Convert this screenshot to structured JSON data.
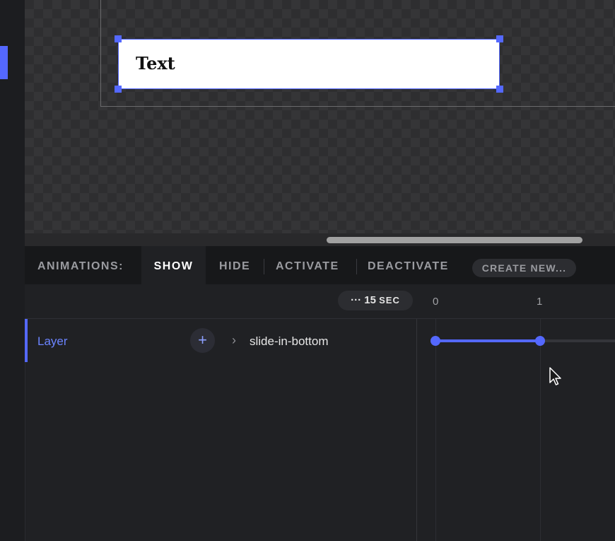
{
  "canvas": {
    "text_layer": {
      "content": "Text"
    }
  },
  "animations": {
    "label": "ANIMATIONS:",
    "tabs": [
      "SHOW",
      "HIDE",
      "ACTIVATE",
      "DEACTIVATE"
    ],
    "active_tab": "SHOW",
    "create_new": "CREATE NEW..."
  },
  "timeline": {
    "duration_dots": "···",
    "duration_value": "15",
    "duration_unit": "SEC",
    "ticks": [
      "0",
      "1"
    ]
  },
  "layer": {
    "name": "Layer",
    "add_symbol": "+",
    "expand_symbol": "›",
    "animation_name": "slide-in-bottom"
  },
  "colors": {
    "accent": "#5468ff",
    "bg": "#202124",
    "tabs_bg": "#17181a"
  },
  "icons": {
    "add": "plus-icon",
    "expand": "chevron-right-icon",
    "cursor": "mouse-pointer-icon"
  }
}
